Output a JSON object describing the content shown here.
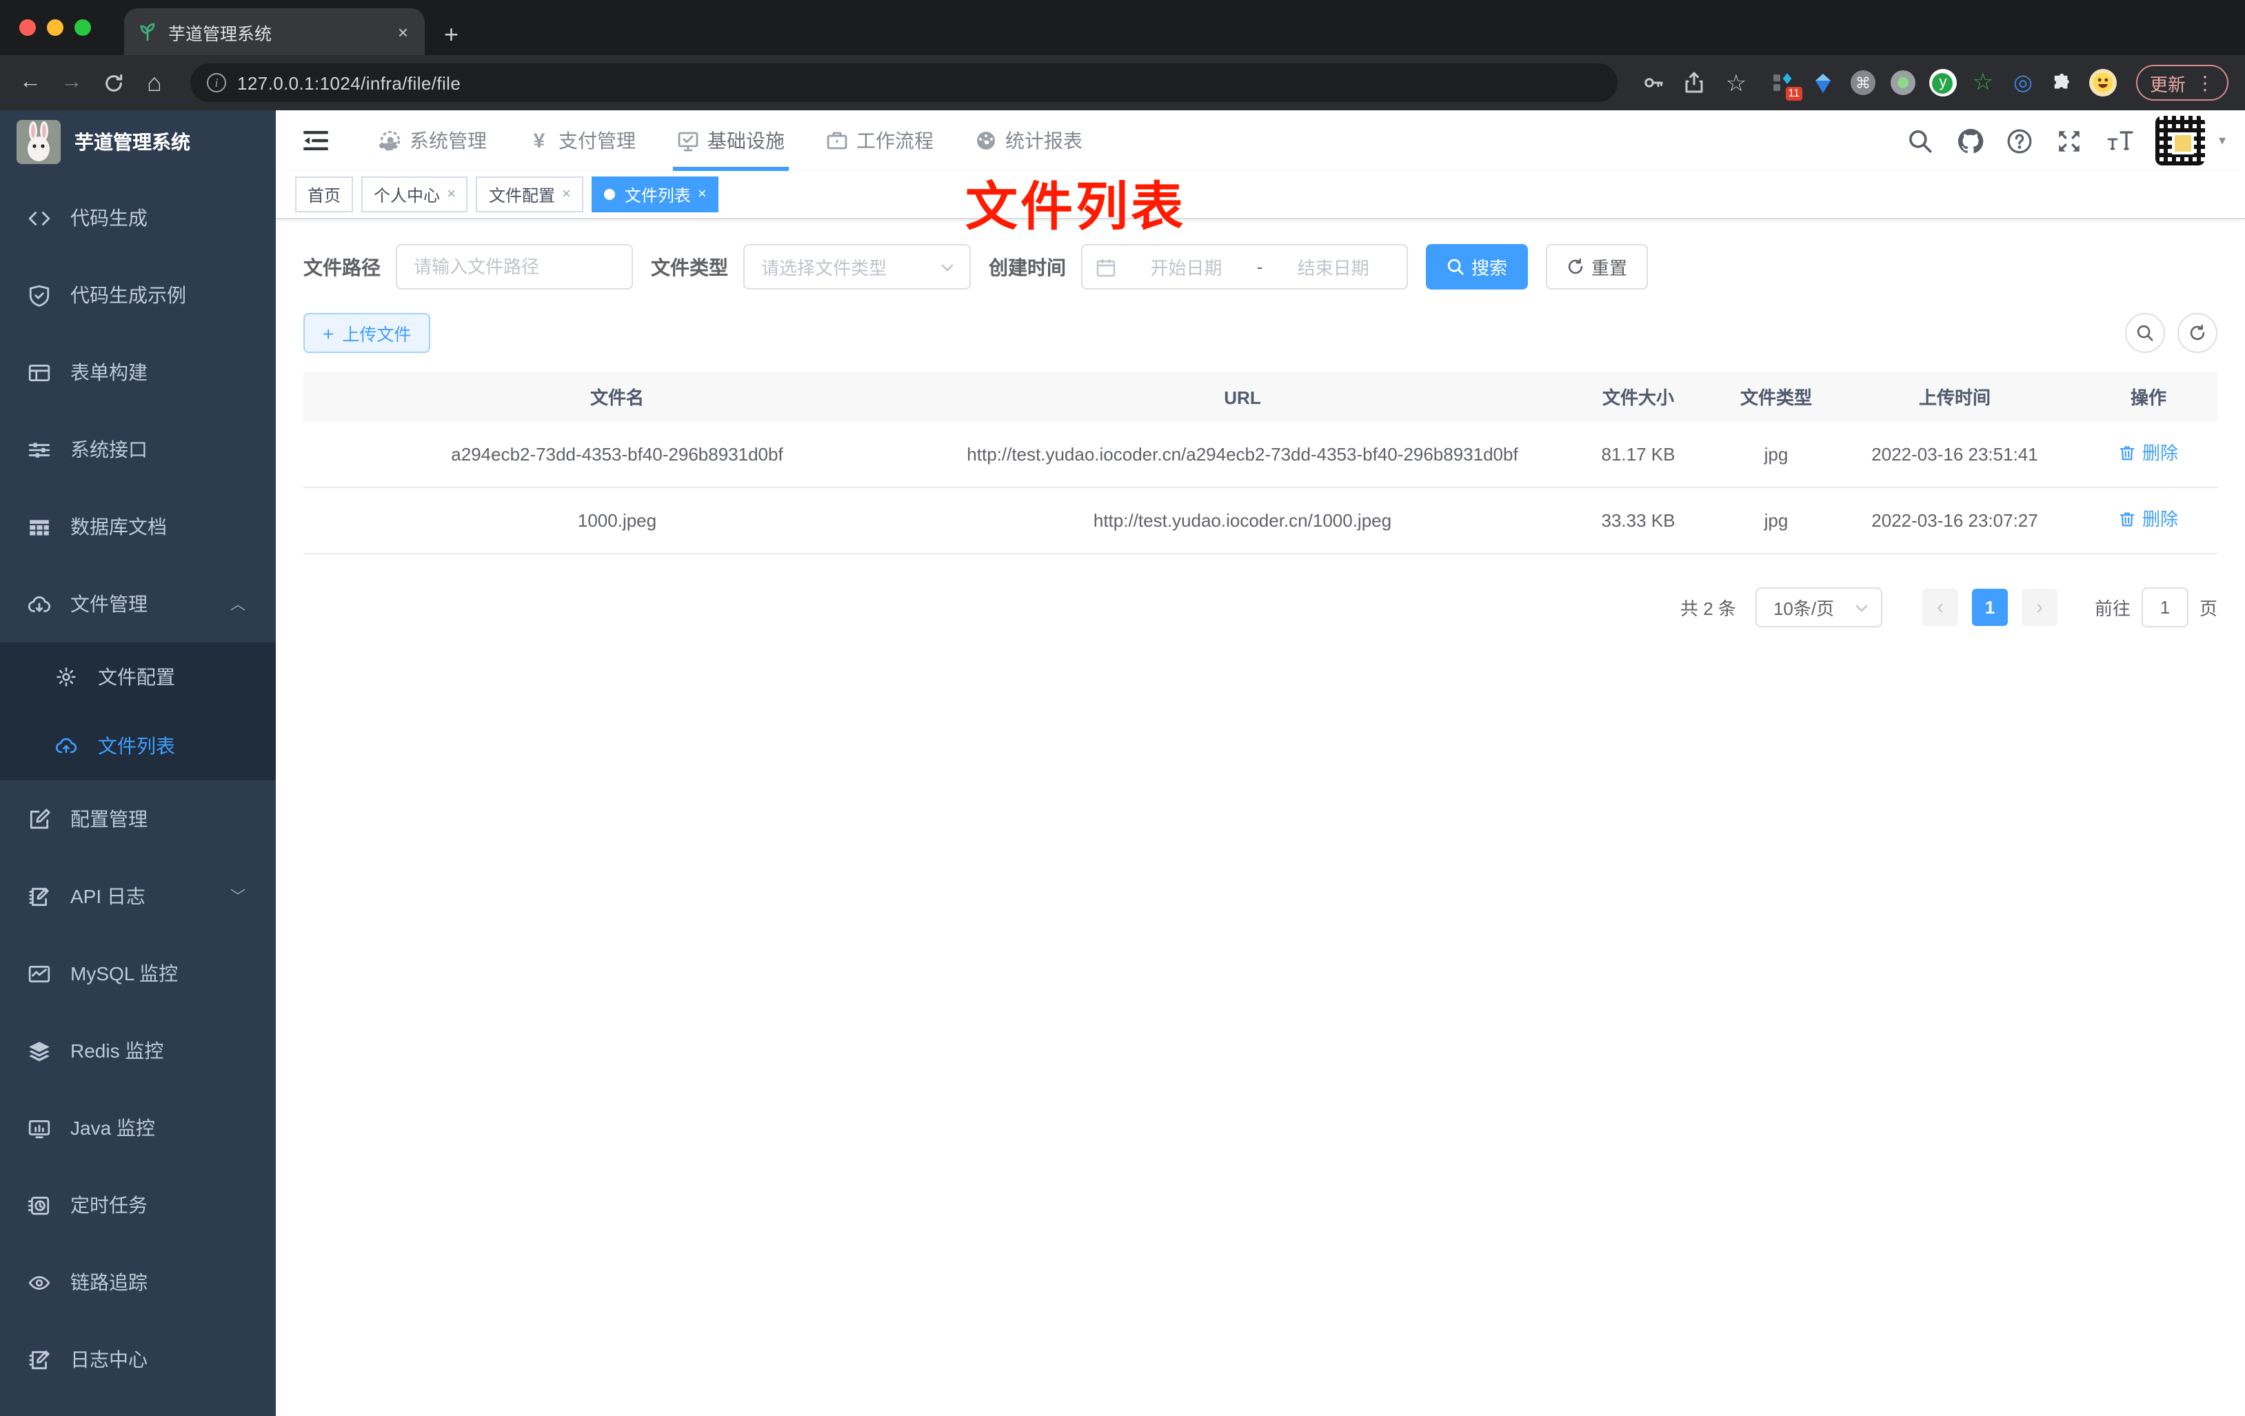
{
  "colors": {
    "accent": "#409eff",
    "annotation_red": "#ff1a00",
    "sidebar_bg": "#2e3c50",
    "submenu_bg": "#1f2d3d"
  },
  "browser": {
    "tab_title": "芋道管理系统",
    "url": "127.0.0.1:1024/infra/file/file",
    "update_label": "更新",
    "extension_badge": "11"
  },
  "icons": {
    "close_x": "×",
    "plus": "+",
    "back": "←",
    "forward": "→",
    "home": "⌂",
    "star": "☆",
    "command": "⌘",
    "target": "◎",
    "dots_v": "⋮",
    "caret_down": "▾",
    "chevron_up": "︿",
    "chevron_down": "﹀",
    "prev": "‹",
    "next": "›",
    "yen": "¥",
    "ext_y": "y"
  },
  "header": {
    "logo_title": "芋道管理系统",
    "nav": [
      {
        "label": "系统管理"
      },
      {
        "label": "支付管理"
      },
      {
        "label": "基础设施"
      },
      {
        "label": "工作流程"
      },
      {
        "label": "统计报表"
      }
    ]
  },
  "tags": {
    "items": [
      {
        "label": "首页"
      },
      {
        "label": "个人中心"
      },
      {
        "label": "文件配置"
      },
      {
        "label": "文件列表"
      }
    ]
  },
  "annotation": {
    "text": "文件列表"
  },
  "sidebar": {
    "items": [
      {
        "label": "代码生成"
      },
      {
        "label": "代码生成示例"
      },
      {
        "label": "表单构建"
      },
      {
        "label": "系统接口"
      },
      {
        "label": "数据库文档"
      },
      {
        "label": "文件管理"
      },
      {
        "label": "配置管理"
      },
      {
        "label": "API 日志"
      },
      {
        "label": "MySQL 监控"
      },
      {
        "label": "Redis 监控"
      },
      {
        "label": "Java 监控"
      },
      {
        "label": "定时任务"
      },
      {
        "label": "链路追踪"
      },
      {
        "label": "日志中心"
      }
    ],
    "file_children": [
      {
        "label": "文件配置"
      },
      {
        "label": "文件列表"
      }
    ]
  },
  "filters": {
    "path_label": "文件路径",
    "path_placeholder": "请输入文件路径",
    "type_label": "文件类型",
    "type_placeholder": "请选择文件类型",
    "date_label": "创建时间",
    "date_start_placeholder": "开始日期",
    "date_separator": "-",
    "date_end_placeholder": "结束日期",
    "search_label": "搜索",
    "reset_label": "重置"
  },
  "toolbar": {
    "upload_label": "上传文件"
  },
  "table": {
    "columns": [
      "文件名",
      "URL",
      "文件大小",
      "文件类型",
      "上传时间",
      "操作"
    ],
    "rows": [
      {
        "name": "a294ecb2-73dd-4353-bf40-296b8931d0bf",
        "url": "http://test.yudao.iocoder.cn/a294ecb2-73dd-4353-bf40-296b8931d0bf",
        "size": "81.17 KB",
        "type": "jpg",
        "time": "2022-03-16 23:51:41",
        "action": "删除"
      },
      {
        "name": "1000.jpeg",
        "url": "http://test.yudao.iocoder.cn/1000.jpeg",
        "size": "33.33 KB",
        "type": "jpg",
        "time": "2022-03-16 23:07:27",
        "action": "删除"
      }
    ]
  },
  "pagination": {
    "total": "共 2 条",
    "page_size": "10条/页",
    "current_page": "1",
    "goto_label": "前往",
    "goto_value": "1",
    "page_unit": "页"
  }
}
